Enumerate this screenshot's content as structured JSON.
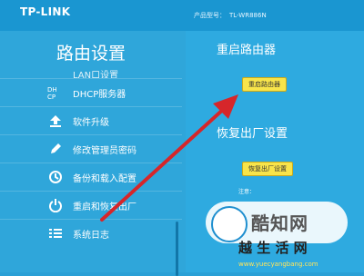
{
  "header": {
    "logo": "TP-LINK",
    "product_label": "产品型号：",
    "product_model": "TL-WR886N"
  },
  "sidebar": {
    "title": "路由设置",
    "items": [
      {
        "label": "LAN口设置",
        "icon": "lan-icon"
      },
      {
        "label": "DHCP服务器",
        "icon": "dhcp-icon"
      },
      {
        "label": "软件升级",
        "icon": "upload-icon"
      },
      {
        "label": "修改管理员密码",
        "icon": "pencil-icon"
      },
      {
        "label": "备份和载入配置",
        "icon": "backup-icon"
      },
      {
        "label": "重启和恢复出厂",
        "icon": "power-icon"
      },
      {
        "label": "系统日志",
        "icon": "list-icon"
      }
    ]
  },
  "main": {
    "reboot_title": "重启路由器",
    "reboot_button": "重启路由器",
    "factory_title": "恢复出厂设置",
    "factory_button": "恢复出厂设置",
    "note": "注意："
  },
  "watermark": {
    "brand": "酷知网",
    "brand2": "越  生  活  网",
    "url": "www.yuecyangbang.com"
  },
  "colors": {
    "header_bg": "#1a96d1",
    "sidebar_bg": "#2fa6da",
    "main_bg": "#2eaae0",
    "button_bg": "#f8e44a",
    "arrow": "#d6262a"
  }
}
